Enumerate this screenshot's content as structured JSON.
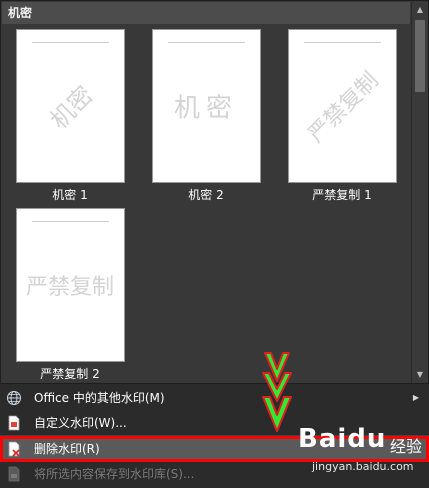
{
  "gallery": {
    "section_title": "机密",
    "items": [
      {
        "label": "机密 1",
        "text": "机密",
        "style": "diagonal"
      },
      {
        "label": "机密 2",
        "text": "机密",
        "style": "horizontal"
      },
      {
        "label": "严禁复制 1",
        "text": "严禁复制",
        "style": "diagonal"
      },
      {
        "label": "严禁复制 2",
        "text": "严禁复制",
        "style": "horizontal"
      }
    ]
  },
  "menu": {
    "office_watermarks": {
      "label": "Office    中的其他水印(M)",
      "icon": "globe-icon"
    },
    "custom_watermark": {
      "label": "自定义水印(W)...",
      "icon": "custom-watermark-icon"
    },
    "remove_watermark": {
      "label": "删除水印(R)",
      "icon": "remove-watermark-icon"
    },
    "save_selection": {
      "label": "将所选内容保存到水印库(S)...",
      "icon": "save-gallery-icon"
    }
  },
  "watermark": {
    "logo": "Baidu",
    "word": "经验",
    "url": "jingyan.baidu.com"
  },
  "colors": {
    "highlight_border": "#ff0000",
    "annotation_arrow": "#33e833",
    "annotation_outline": "#e02020"
  }
}
